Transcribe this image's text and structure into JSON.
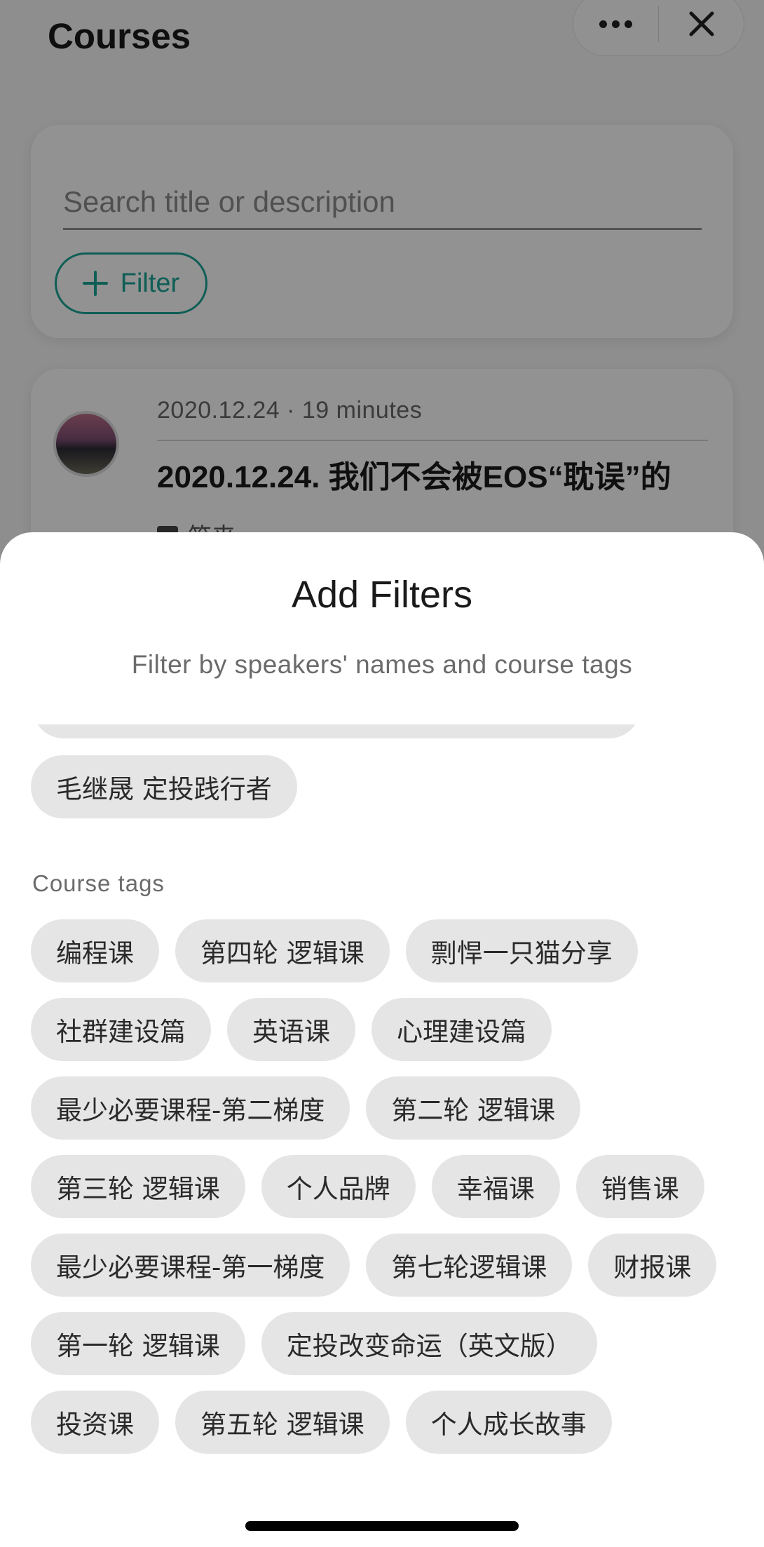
{
  "background": {
    "title": "Courses",
    "search": {
      "placeholder": "Search title or description"
    },
    "filter_button": "Filter",
    "course": {
      "meta": "2020.12.24 · 19 minutes",
      "title": "2020.12.24. 我们不会被EOS“耽误”的",
      "speaker": "笑来"
    }
  },
  "capsule": {
    "more_icon": "more-dots-icon",
    "close_icon": "close-icon"
  },
  "sheet": {
    "title": "Add Filters",
    "subtitle": "Filter by speakers' names and course tags",
    "speakers": [
      "毛继晟 定投践行者"
    ],
    "course_tags_label": "Course tags",
    "course_tags": [
      "编程课",
      "第四轮 逻辑课",
      "剽悍一只猫分享",
      "社群建设篇",
      "英语课",
      "心理建设篇",
      "最少必要课程-第二梯度",
      "第二轮 逻辑课",
      "第三轮 逻辑课",
      "个人品牌",
      "幸福课",
      "销售课",
      "最少必要课程-第一梯度",
      "第七轮逻辑课",
      "财报课",
      "第一轮 逻辑课",
      "定投改变命运（英文版）",
      "投资课",
      "第五轮 逻辑课",
      "个人成长故事"
    ]
  },
  "colors": {
    "accent": "#1aa394",
    "chip_bg": "#e5e5e5",
    "overlay": "rgba(0,0,0,0.42)"
  }
}
